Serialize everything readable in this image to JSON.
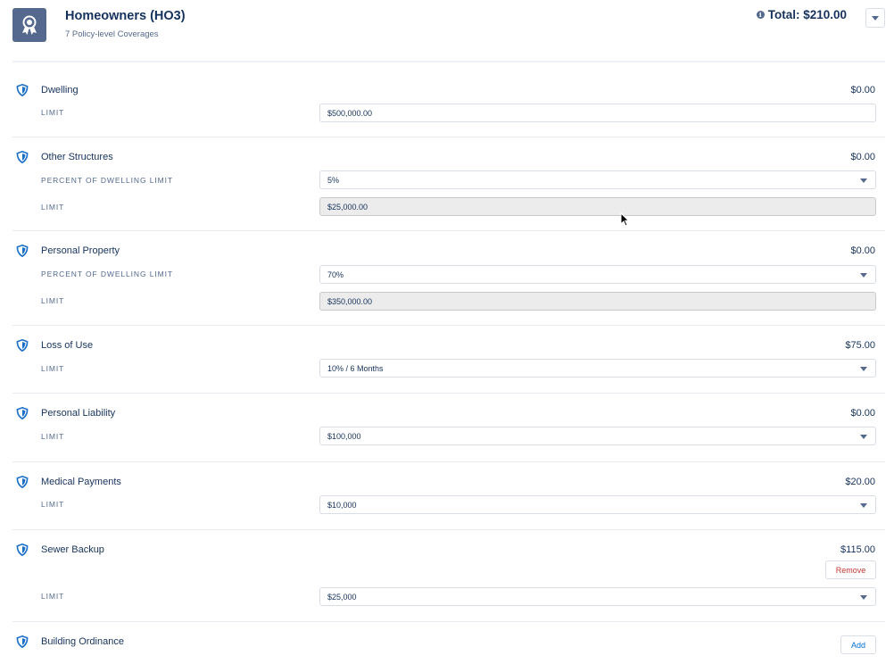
{
  "header": {
    "title": "Homeowners (HO3)",
    "subtitle": "7 Policy-level Coverages",
    "total": "Total: $210.00",
    "app_icon": "award-icon",
    "info_icon": "info-icon",
    "menu_icon": "chevron-down-icon"
  },
  "coverages": [
    {
      "name": "Dwelling",
      "amount": "$0.00",
      "fields": [
        {
          "label": "LIMIT",
          "value": "$500,000.00",
          "kind": "text"
        }
      ]
    },
    {
      "name": "Other Structures",
      "amount": "$0.00",
      "fields": [
        {
          "label": "PERCENT OF DWELLING LIMIT",
          "value": "5%",
          "kind": "select"
        },
        {
          "label": "LIMIT",
          "value": "$25,000.00",
          "kind": "readonly"
        }
      ]
    },
    {
      "name": "Personal Property",
      "amount": "$0.00",
      "fields": [
        {
          "label": "PERCENT OF DWELLING LIMIT",
          "value": "70%",
          "kind": "select"
        },
        {
          "label": "LIMIT",
          "value": "$350,000.00",
          "kind": "readonly"
        }
      ]
    },
    {
      "name": "Loss of Use",
      "amount": "$75.00",
      "fields": [
        {
          "label": "LIMIT",
          "value": "10% / 6 Months",
          "kind": "select"
        }
      ]
    },
    {
      "name": "Personal Liability",
      "amount": "$0.00",
      "fields": [
        {
          "label": "LIMIT",
          "value": "$100,000",
          "kind": "select"
        }
      ]
    },
    {
      "name": "Medical Payments",
      "amount": "$20.00",
      "fields": [
        {
          "label": "LIMIT",
          "value": "$10,000",
          "kind": "select"
        }
      ]
    },
    {
      "name": "Sewer Backup",
      "amount": "$115.00",
      "action": "Remove",
      "fields": [
        {
          "label": "LIMIT",
          "value": "$25,000",
          "kind": "select"
        }
      ]
    },
    {
      "name": "Building Ordinance",
      "action": "Add",
      "fields": []
    }
  ],
  "colors": {
    "accent": "#0070d2",
    "remove": "#c23934",
    "icon_bg": "#54698d",
    "text": "#16325c"
  }
}
